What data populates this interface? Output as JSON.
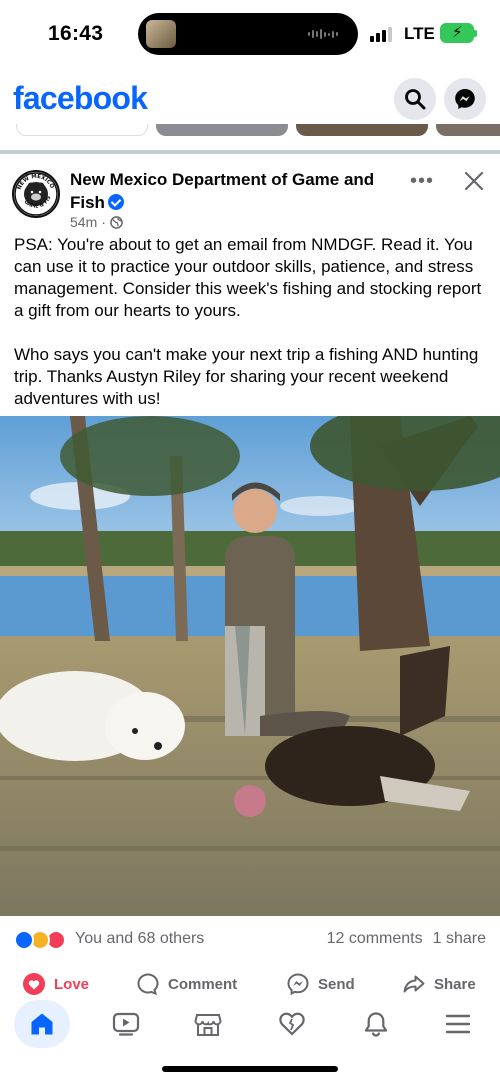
{
  "status_bar": {
    "time": "16:43",
    "network": "LTE",
    "battery_state": "charging"
  },
  "header": {
    "logo_text": "facebook",
    "search_icon": "search-icon",
    "messenger_icon": "messenger-icon"
  },
  "post": {
    "page_name": "New Mexico Department of Game and Fish",
    "verified": true,
    "time_ago": "54m",
    "audience_icon": "globe-icon",
    "text_paragraphs": [
      "PSA: You're about to get an email from NMDGF. Read it. You can use it to practice your outdoor skills, patience, and stress management. Consider this week's fishing and stocking report a gift from our hearts to yours.",
      "Who says you can't make your next trip a fishing AND hunting trip. Thanks Austyn Riley for sharing your recent weekend adventures with us!"
    ],
    "avatar_text": "NEW MEXICO GAME & FISH",
    "photo_alt": "Child holding fish next to a white dog and a turkey by a lake"
  },
  "reactions": {
    "types": [
      "like",
      "haha",
      "love"
    ],
    "reactors_text": "You and 68 others",
    "comments": "12 comments",
    "shares": "1 share"
  },
  "actions": [
    {
      "label": "Love",
      "icon": "love-icon"
    },
    {
      "label": "Comment",
      "icon": "comment-icon"
    },
    {
      "label": "Send",
      "icon": "messenger-send-icon"
    },
    {
      "label": "Share",
      "icon": "share-icon"
    }
  ],
  "bottom_nav": [
    {
      "name": "home",
      "icon": "home-icon",
      "active": true
    },
    {
      "name": "video",
      "icon": "video-icon",
      "active": false
    },
    {
      "name": "marketplace",
      "icon": "marketplace-icon",
      "active": false
    },
    {
      "name": "dating",
      "icon": "heart-icon",
      "active": false
    },
    {
      "name": "notifications",
      "icon": "bell-icon",
      "active": false
    },
    {
      "name": "menu",
      "icon": "menu-icon",
      "active": false
    }
  ],
  "colors": {
    "brand_blue": "#0866ff",
    "love_red": "#f33e58",
    "secondary_text": "#65676b"
  }
}
